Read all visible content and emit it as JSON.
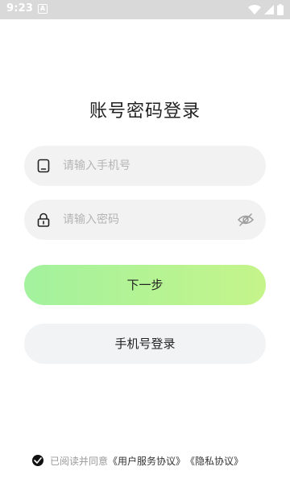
{
  "status_bar": {
    "time": "9:23",
    "notification_glyph": "A",
    "icons": [
      "wifi-icon",
      "signal-icon",
      "battery-icon"
    ]
  },
  "page_title": "账号密码登录",
  "account_field": {
    "placeholder": "请输入手机号",
    "value": "",
    "icon": "phone-icon"
  },
  "password_field": {
    "placeholder": "请输入密码",
    "value": "",
    "icon": "lock-icon",
    "toggle_icon": "eye-off-icon"
  },
  "next_button": {
    "label": "下一步"
  },
  "phone_login_button": {
    "label": "手机号登录"
  },
  "agreement": {
    "checked": true,
    "prefix": "已阅读并同意",
    "user_agreement": "《用户服务协议》",
    "privacy_policy": "《隐私协议》"
  },
  "colors": {
    "primary_gradient_start": "#a3f29e",
    "primary_gradient_end": "#c5f48a",
    "field_bg": "#f2f2f2",
    "statusbar_bg": "#d9d9d9"
  }
}
